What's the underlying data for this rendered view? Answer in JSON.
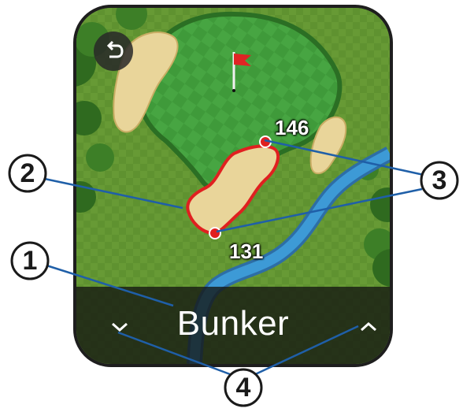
{
  "screen": {
    "hazard_name": "Bunker",
    "distances": {
      "far": "146",
      "near": "131"
    }
  },
  "buttons": {
    "back_icon": "back-arrow-icon",
    "prev_icon": "chevron-down-icon",
    "next_icon": "chevron-up-icon"
  },
  "callouts": [
    "1",
    "2",
    "3",
    "4"
  ],
  "colors": {
    "fairway": "#5a8a2e",
    "green": "#3f9a3a",
    "sand": "#e9d59a",
    "water": "#3a8fd0",
    "highlight": "#e02020",
    "flag": "#e02424"
  }
}
